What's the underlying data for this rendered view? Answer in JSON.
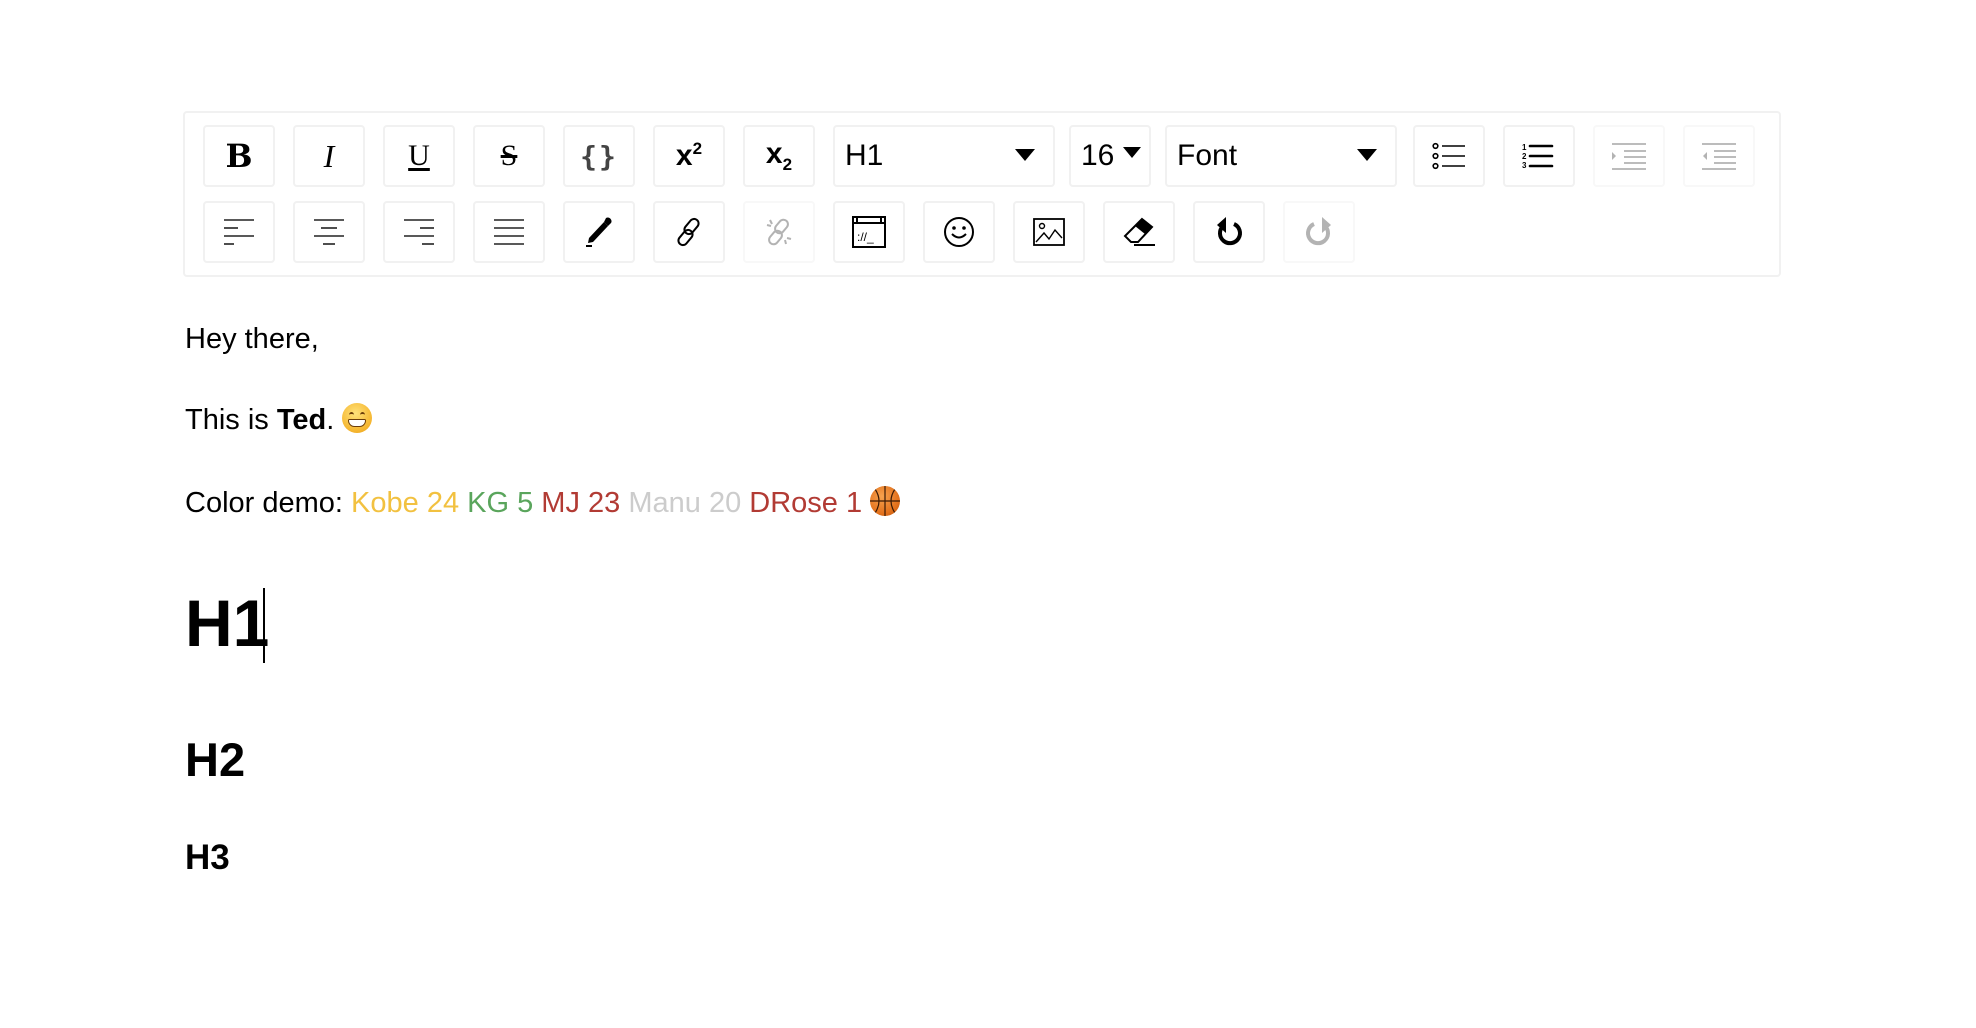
{
  "toolbar": {
    "row1": [
      {
        "id": "bold",
        "label": "B",
        "icon": "bold-icon",
        "disabled": false
      },
      {
        "id": "italic",
        "label": "I",
        "icon": "italic-icon",
        "disabled": false
      },
      {
        "id": "underline",
        "label": "U",
        "icon": "underline-icon",
        "disabled": false
      },
      {
        "id": "strikethrough",
        "label": "S",
        "icon": "strikethrough-icon",
        "disabled": false
      },
      {
        "id": "code",
        "label": "{}",
        "icon": "code-icon",
        "disabled": false
      },
      {
        "id": "superscript",
        "label": "x",
        "sup": "2",
        "icon": "superscript-icon",
        "disabled": false
      },
      {
        "id": "subscript",
        "label": "x",
        "sub": "2",
        "icon": "subscript-icon",
        "disabled": false
      }
    ],
    "block_type_select": {
      "value": "H1"
    },
    "font_size_select": {
      "value": "16"
    },
    "font_family_select": {
      "value": "Font"
    },
    "row1_right": [
      {
        "id": "unordered-list",
        "icon": "bullet-list-icon",
        "disabled": false
      },
      {
        "id": "ordered-list",
        "icon": "numbered-list-icon",
        "disabled": false
      },
      {
        "id": "indent",
        "icon": "indent-icon",
        "disabled": true
      },
      {
        "id": "outdent",
        "icon": "outdent-icon",
        "disabled": true
      }
    ],
    "row2": [
      {
        "id": "align-left",
        "icon": "align-left-icon",
        "disabled": false
      },
      {
        "id": "align-center",
        "icon": "align-center-icon",
        "disabled": false
      },
      {
        "id": "align-right",
        "icon": "align-right-icon",
        "disabled": false
      },
      {
        "id": "align-justify",
        "icon": "align-justify-icon",
        "disabled": false
      },
      {
        "id": "color-picker",
        "icon": "eyedropper-icon",
        "disabled": false
      },
      {
        "id": "link",
        "icon": "link-icon",
        "disabled": false
      },
      {
        "id": "unlink",
        "icon": "unlink-icon",
        "disabled": true
      },
      {
        "id": "embedded",
        "icon": "embed-icon",
        "disabled": false
      },
      {
        "id": "emoji",
        "icon": "emoji-icon",
        "disabled": false
      },
      {
        "id": "image",
        "icon": "image-icon",
        "disabled": false
      },
      {
        "id": "remove-format",
        "icon": "eraser-icon",
        "disabled": false
      },
      {
        "id": "undo",
        "icon": "undo-icon",
        "disabled": false
      },
      {
        "id": "redo",
        "icon": "redo-icon",
        "disabled": true
      }
    ]
  },
  "colors": {
    "icon": "#000000",
    "icon_disabled": "#b3b3b3",
    "border": "#f1f1f1"
  },
  "content": {
    "greeting": "Hey there,",
    "intro": {
      "prefix": "This is ",
      "bold": "Ted",
      "suffix": ".",
      "emoji": "grinning-face"
    },
    "color_demo": {
      "label": "Color demo:",
      "items": [
        {
          "text": "Kobe 24",
          "color": "#f2c140"
        },
        {
          "text": "KG 5",
          "color": "#5aa55c"
        },
        {
          "text": "MJ 23",
          "color": "#b23b34"
        },
        {
          "text": "Manu 20",
          "color": "#cccccc"
        },
        {
          "text": "DRose 1",
          "color": "#b23b34"
        }
      ],
      "emoji": "basketball"
    },
    "h1": "H1",
    "h2": "H2",
    "h3": "H3"
  }
}
